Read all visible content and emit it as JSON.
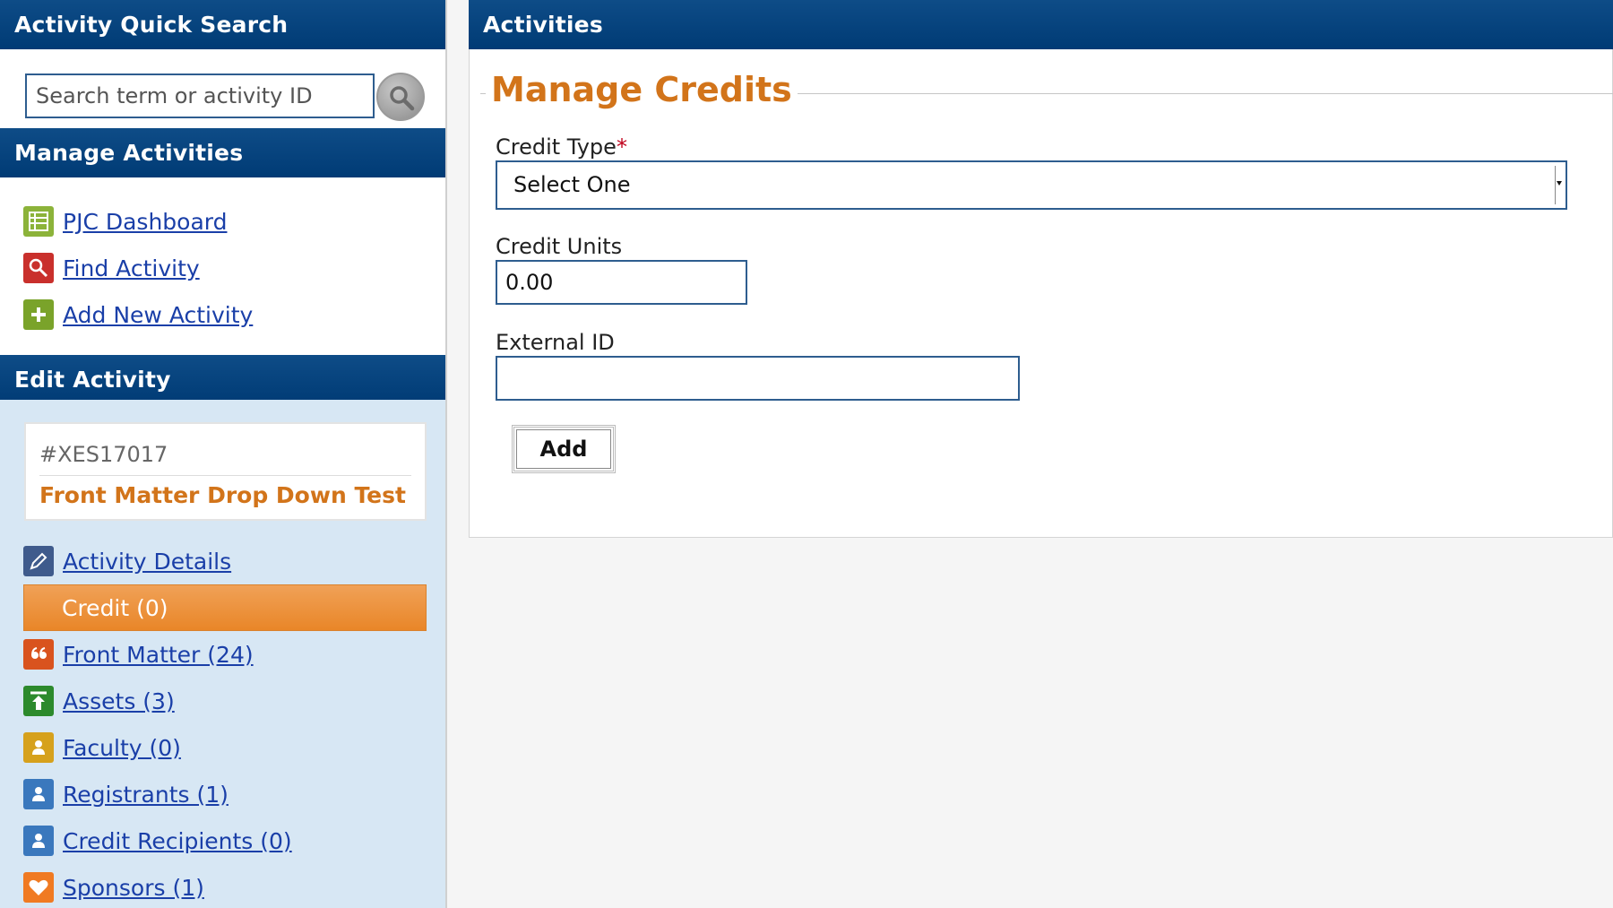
{
  "quick_search": {
    "header": "Activity Quick Search",
    "placeholder": "Search term or activity ID"
  },
  "manage_activities": {
    "header": "Manage Activities",
    "items": [
      {
        "label": "PJC Dashboard",
        "icon": "dashboard-icon",
        "color": "#8cb33a"
      },
      {
        "label": "Find Activity",
        "icon": "search-icon",
        "color": "#c9302c"
      },
      {
        "label": "Add New Activity",
        "icon": "plus-icon",
        "color": "#7aa32a"
      }
    ]
  },
  "edit_activity": {
    "header": "Edit Activity",
    "activity_id": "#XES17017",
    "activity_title": "Front Matter Drop Down Test",
    "items": [
      {
        "label": "Activity Details",
        "icon": "pencil-icon",
        "color": "#3f5b8c",
        "active": false
      },
      {
        "label": "Credit (0)",
        "icon": "",
        "color": "#e98628",
        "active": true
      },
      {
        "label": "Front Matter (24)",
        "icon": "quote-icon",
        "color": "#d9531e",
        "active": false
      },
      {
        "label": "Assets (3)",
        "icon": "upload-icon",
        "color": "#2c8a2c",
        "active": false
      },
      {
        "label": "Faculty (0)",
        "icon": "person-icon",
        "color": "#d6a11c",
        "active": false
      },
      {
        "label": "Registrants (1)",
        "icon": "person-icon",
        "color": "#3a78bd",
        "active": false
      },
      {
        "label": "Credit Recipients (0)",
        "icon": "person-icon",
        "color": "#3a78bd",
        "active": false
      },
      {
        "label": "Sponsors (1)",
        "icon": "heart-icon",
        "color": "#f07a22",
        "active": false
      }
    ]
  },
  "activities": {
    "header": "Activities",
    "section_title": "Manage Credits",
    "credit_type_label": "Credit Type",
    "required_mark": "*",
    "credit_type_value": "Select One",
    "credit_units_label": "Credit Units",
    "credit_units_value": "0.00",
    "external_id_label": "External ID",
    "external_id_value": "",
    "add_label": "Add"
  },
  "colors": {
    "header_blue": "#003b75",
    "accent_orange": "#d2741a",
    "link_blue": "#1a3fa8",
    "sidebar_bg": "#d7e7f4"
  }
}
